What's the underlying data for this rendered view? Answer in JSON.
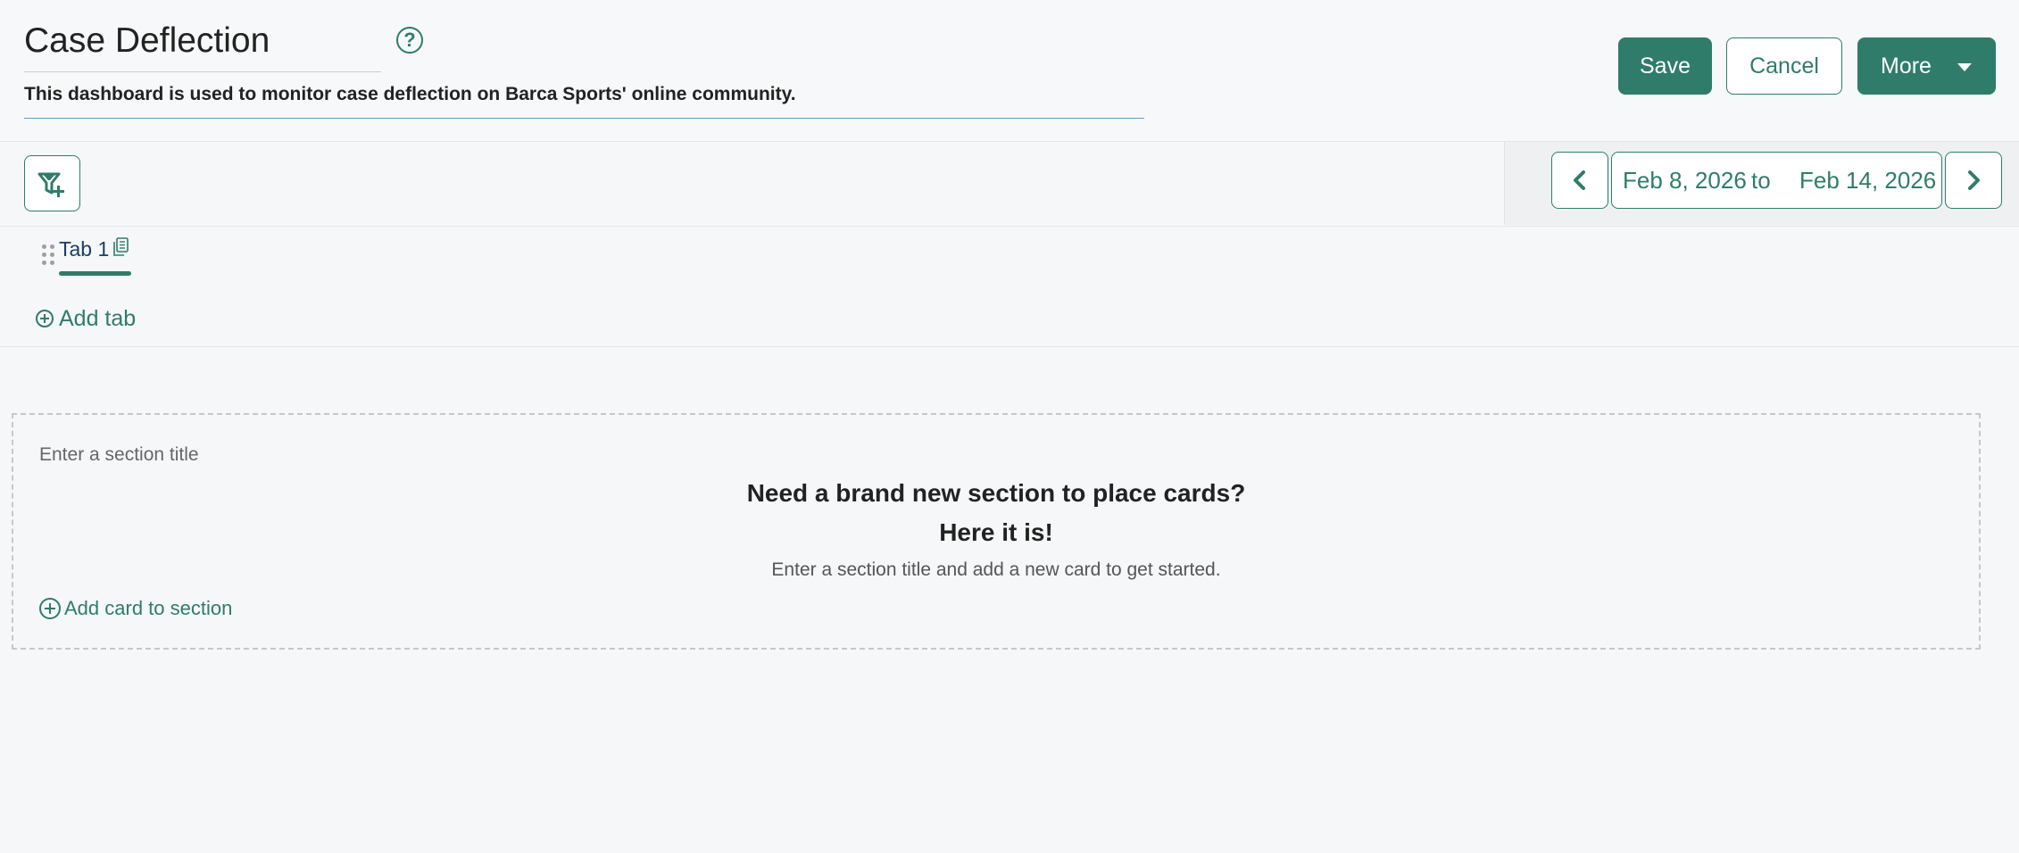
{
  "header": {
    "title": "Case Deflection",
    "description": "This dashboard is used to monitor case deflection on Barca Sports' online community.",
    "help_icon": "question-circle-icon",
    "save_label": "Save",
    "cancel_label": "Cancel",
    "more_label": "More"
  },
  "toolbar": {
    "filter_icon": "filter-add-icon",
    "date_start": "Feb 8, 2026",
    "date_separator": "to",
    "date_end": "Feb 14, 2026"
  },
  "tabs": {
    "items": [
      {
        "label": "Tab 1"
      }
    ],
    "add_tab_label": "Add tab"
  },
  "section": {
    "title_placeholder": "Enter a section title",
    "empty_heading_1": "Need a brand new section to place cards?",
    "empty_heading_2": "Here it is!",
    "empty_text": "Enter a section title and add a new card to get started.",
    "add_card_label": "Add card to section"
  },
  "colors": {
    "accent": "#2f7c6a",
    "background": "#f6f7f9",
    "tab_text": "#1b3f66",
    "description_underline": "#5aa0c8"
  }
}
